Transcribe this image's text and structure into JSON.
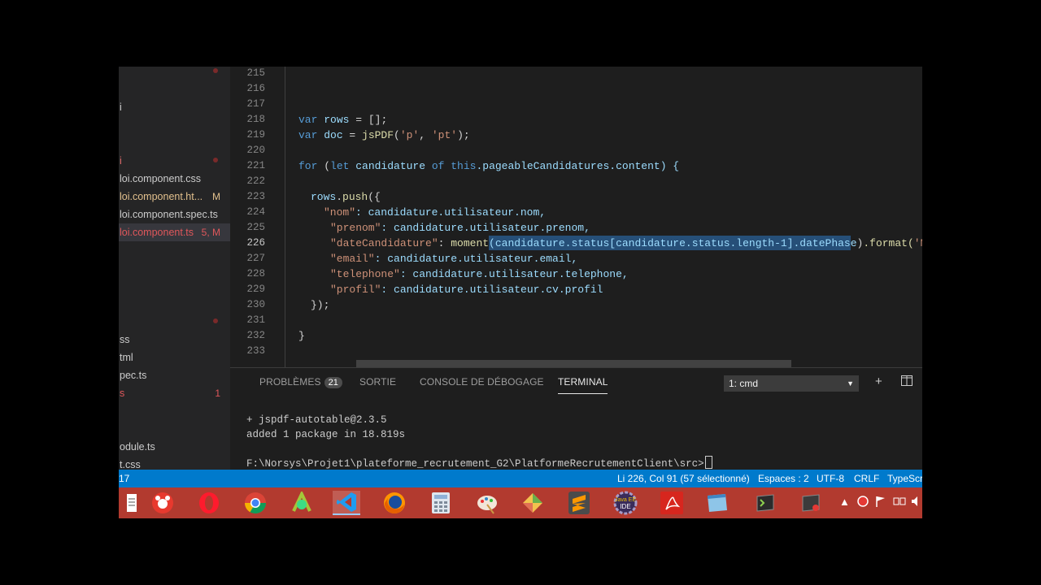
{
  "sidebar": {
    "items": [
      {
        "name": "i",
        "badge": ""
      },
      {
        "name": "loi.component.css",
        "badge": ""
      },
      {
        "name": "loi.component.ht...",
        "badge": "M"
      },
      {
        "name": "loi.component.spec.ts",
        "badge": ""
      },
      {
        "name": "loi.component.ts",
        "badge": "5, M"
      },
      {
        "name": "ss",
        "badge": ""
      },
      {
        "name": "tml",
        "badge": ""
      },
      {
        "name": "pec.ts",
        "badge": ""
      },
      {
        "name": "s",
        "badge": "1"
      },
      {
        "name": "odule.ts",
        "badge": ""
      },
      {
        "name": "t.css",
        "badge": ""
      }
    ]
  },
  "editor": {
    "line_numbers": [
      "215",
      "216",
      "217",
      "218",
      "219",
      "220",
      "221",
      "222",
      "223",
      "224",
      "225",
      "226",
      "227",
      "228",
      "229",
      "230",
      "231",
      "232",
      "233"
    ],
    "active_line": "226",
    "code": {
      "l218_kw": "var",
      "l218_var": "rows",
      "l218_rest": " = [];",
      "l219_kw": "var",
      "l219_var": "doc",
      "l219_eq": " = ",
      "l219_fn": "jsPDF",
      "l219_p1": "(",
      "l219_s1": "'p'",
      "l219_c": ", ",
      "l219_s2": "'pt'",
      "l219_end": ");",
      "l221_kw": "for",
      "l221_p": " (",
      "l221_let": "let",
      "l221_var": " candidature ",
      "l221_of": "of",
      "l221_this": " this",
      "l221_rest": ".pageableCandidatures.content) {",
      "l223_var": "rows",
      "l223_dot": ".",
      "l223_fn": "push",
      "l223_rest": "({",
      "l224_key": "\"nom\"",
      "l224_rest": ": candidature.utilisateur.nom,",
      "l225_key": "\"prenom\"",
      "l225_rest": ": candidature.utilisateur.prenom,",
      "l226_key": "\"dateCandidature\"",
      "l226_colon": ": ",
      "l226_fn": "moment",
      "l226_sel": "(candidature.status[candidature.status.length-1].datePhase",
      "l226_close": ")",
      "l226_fn2": ".format(",
      "l226_s": "'MM",
      "l227_key": "\"email\"",
      "l227_rest": ": candidature.utilisateur.email,",
      "l228_key": "\"telephone\"",
      "l228_rest": ": candidature.utilisateur.telephone,",
      "l229_key": "\"profil\"",
      "l229_rest": ": candidature.utilisateur.cv.profil",
      "l230": "});",
      "l232": "}"
    }
  },
  "panel": {
    "tabs": [
      {
        "label": "PROBLÈMES",
        "badge": "21"
      },
      {
        "label": "SORTIE"
      },
      {
        "label": "CONSOLE DE DÉBOGAGE"
      },
      {
        "label": "TERMINAL"
      }
    ],
    "active_tab": "TERMINAL",
    "terminal_select": "1: cmd",
    "terminal_lines": [
      "+ jspdf-autotable@2.3.5",
      "added 1 package in 18.819s",
      "F:\\Norsys\\Projet1\\plateforme_recrutement_G2\\PlatformeRecrutementClient\\src>"
    ]
  },
  "statusbar": {
    "left": "17",
    "position": "Li 226, Col 91 (57 sélectionné)",
    "spaces": "Espaces : 2",
    "encoding": "UTF-8",
    "eol": "CRLF",
    "language": "TypeScr"
  },
  "taskbar": {
    "icons": [
      "file-icon",
      "snagit-icon",
      "opera-icon",
      "chrome-icon",
      "android-studio-icon",
      "vscode-icon",
      "firefox-icon",
      "calculator-icon",
      "paint-icon",
      "photos-icon",
      "sublime-icon",
      "java-ee-ide-icon",
      "acrobat-icon",
      "notepad-icon",
      "terminal-icon",
      "vpn-icon"
    ],
    "active": "vscode-icon"
  }
}
